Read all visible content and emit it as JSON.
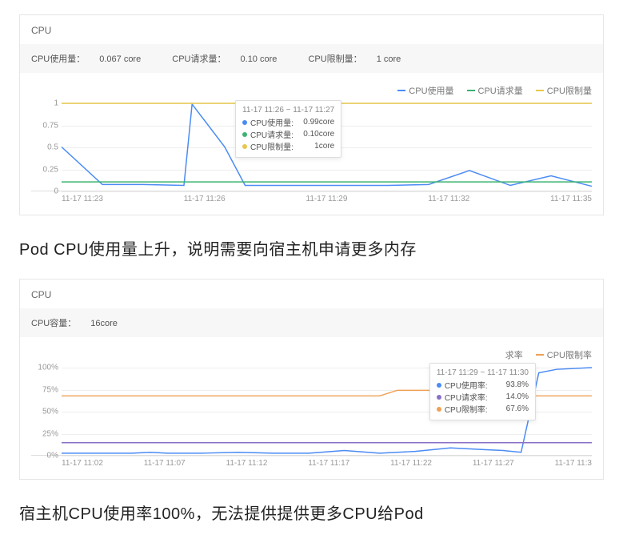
{
  "panel1": {
    "title": "CPU",
    "sub": [
      {
        "label": "CPU使用量：",
        "value": "0.067 core"
      },
      {
        "label": "CPU请求量：",
        "value": "0.10 core"
      },
      {
        "label": "CPU限制量：",
        "value": "1 core"
      }
    ],
    "legend": [
      {
        "name": "CPU使用量",
        "color": "#4b8bf4"
      },
      {
        "name": "CPU请求量",
        "color": "#3cb371"
      },
      {
        "name": "CPU限制量",
        "color": "#e6c84c"
      }
    ],
    "tooltip": {
      "title": "11-17 11:26 ~ 11-17 11:27",
      "rows": [
        {
          "dot": "#4b8bf4",
          "label": "CPU使用量:",
          "value": "0.99core"
        },
        {
          "dot": "#3cb371",
          "label": "CPU请求量:",
          "value": "0.10core"
        },
        {
          "dot": "#e6c84c",
          "label": "CPU限制量:",
          "value": "1core"
        }
      ]
    }
  },
  "panel2": {
    "title": "CPU",
    "sub": [
      {
        "label": "CPU容量：",
        "value": "16core"
      }
    ],
    "legend": [
      {
        "name": "CPU使用率",
        "color": "#4b8bf4",
        "hidden_label": "求率"
      },
      {
        "name": "CPU限制率",
        "color": "#f0a055"
      }
    ],
    "tooltip": {
      "title": "11-17 11:29 ~ 11-17 11:30",
      "rows": [
        {
          "dot": "#4b8bf4",
          "label": "CPU使用率:",
          "value": "93.8%"
        },
        {
          "dot": "#8a6fc9",
          "label": "CPU请求率:",
          "value": "14.0%"
        },
        {
          "dot": "#f0a055",
          "label": "CPU限制率:",
          "value": "67.6%"
        }
      ]
    }
  },
  "caption1": "Pod CPU使用量上升，说明需要向宿主机申请更多内存",
  "caption2": "宿主机CPU使用率100%，无法提供提供更多CPU给Pod",
  "chart_data": [
    {
      "type": "line",
      "title": "CPU",
      "xlabel": "",
      "ylabel": "",
      "ylim": [
        0,
        1
      ],
      "x_categories": [
        "11-17 11:23",
        "11-17 11:26",
        "11-17 11:29",
        "11-17 11:32",
        "11-17 11:35"
      ],
      "y_ticks": [
        0,
        0.25,
        0.5,
        0.75,
        1
      ],
      "series": [
        {
          "name": "CPU使用量",
          "color": "#4b8bf4",
          "x": [
            0,
            1,
            2,
            3,
            3.2,
            4,
            4.5,
            5,
            6,
            7,
            8,
            9,
            10,
            11,
            12,
            13
          ],
          "y": [
            0.5,
            0.07,
            0.07,
            0.06,
            0.99,
            0.5,
            0.06,
            0.06,
            0.06,
            0.06,
            0.06,
            0.07,
            0.23,
            0.06,
            0.17,
            0.05
          ]
        },
        {
          "name": "CPU请求量",
          "color": "#3cb371",
          "x": [
            0,
            13
          ],
          "y": [
            0.1,
            0.1
          ]
        },
        {
          "name": "CPU限制量",
          "color": "#e6c84c",
          "x": [
            0,
            13
          ],
          "y": [
            1.0,
            1.0
          ]
        }
      ],
      "xlim": [
        0,
        13
      ]
    },
    {
      "type": "line",
      "title": "CPU",
      "xlabel": "",
      "ylabel": "",
      "ylim": [
        0,
        100
      ],
      "x_categories": [
        "11-17 11:02",
        "11-17 11:07",
        "11-17 11:12",
        "11-17 11:17",
        "11-17 11:22",
        "11-17 11:27",
        "11-17 11:3"
      ],
      "y_ticks": [
        "0%",
        "25%",
        "50%",
        "75%",
        "100%"
      ],
      "series": [
        {
          "name": "CPU使用率",
          "color": "#4b8bf4",
          "x": [
            0,
            4,
            5,
            6,
            8,
            10,
            12,
            14,
            16,
            18,
            20,
            22,
            24,
            25,
            26,
            27,
            28,
            30
          ],
          "y": [
            2,
            2,
            3,
            2,
            2,
            3,
            2,
            2,
            5,
            2,
            4,
            8,
            6,
            5,
            3,
            94,
            98,
            100
          ]
        },
        {
          "name": "CPU请求率",
          "color": "#8a6fc9",
          "x": [
            0,
            30
          ],
          "y": [
            14,
            14
          ]
        },
        {
          "name": "CPU限制率",
          "color": "#f0a055",
          "x": [
            0,
            18,
            19,
            23,
            24,
            30
          ],
          "y": [
            67.6,
            67.6,
            74,
            74,
            67.6,
            67.6
          ]
        }
      ],
      "xlim": [
        0,
        30
      ]
    }
  ]
}
